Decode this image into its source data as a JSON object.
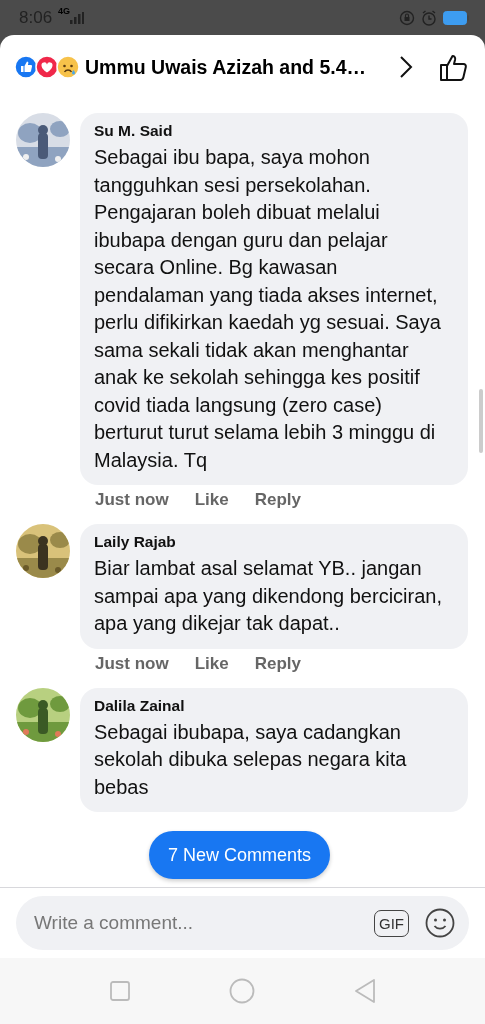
{
  "status_bar": {
    "time": "8:06",
    "network": "4G"
  },
  "header": {
    "title": "Ummu Uwais Azizah and 5.4…"
  },
  "comments": [
    {
      "author": "Su M. Said",
      "text": "Sebagai ibu bapa, saya mohon tangguhkan sesi persekolahan. Pengajaran boleh dibuat melalui ibubapa dengan guru dan pelajar secara Online. Bg kawasan pendalaman yang tiada akses internet,  perlu difikirkan kaedah yg sesuai.  Saya sama sekali tidak akan menghantar anak ke sekolah sehingga kes positif covid tiada langsung (zero case) berturut turut selama lebih 3 minggu di Malaysia. Tq",
      "actions": [
        "Just now",
        "Like",
        "Reply"
      ]
    },
    {
      "author": "Laily Rajab",
      "text": "Biar lambat asal selamat YB.. jangan sampai apa yang dikendong berciciran, apa yang dikejar tak dapat..",
      "actions": [
        "Just now",
        "Like",
        "Reply"
      ]
    },
    {
      "author": "Dalila Zainal",
      "text": "Sebagai ibubapa, saya cadangkan sekolah dibuka selepas negara kita bebas"
    }
  ],
  "new_comments_button": "7 New Comments",
  "composer": {
    "placeholder": "Write a comment...",
    "gif": "GIF"
  }
}
